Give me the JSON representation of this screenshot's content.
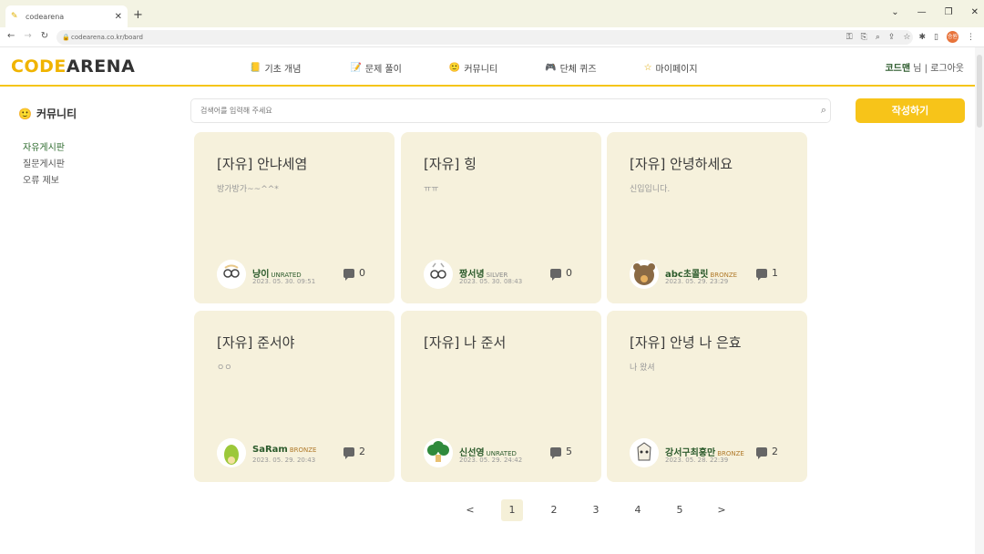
{
  "browser": {
    "tab_title": "codearena",
    "url": "codearena.co.kr/board",
    "profile_initials": "승원"
  },
  "site": {
    "logo_code": "CODE",
    "logo_arena": "ARENA",
    "nav": [
      {
        "label": "기초 개념",
        "icon": "book-icon"
      },
      {
        "label": "문제 풀이",
        "icon": "note-icon"
      },
      {
        "label": "커뮤니티",
        "icon": "community-icon"
      },
      {
        "label": "단체 퀴즈",
        "icon": "gamepad-icon"
      },
      {
        "label": "마이페이지",
        "icon": "star-icon"
      }
    ],
    "user_name": "코드맨",
    "user_suffix": "님 | 로그아웃"
  },
  "sidebar": {
    "title": "커뮤니티",
    "items": [
      "자유게시판",
      "질문게시판",
      "오류 제보"
    ]
  },
  "search": {
    "placeholder": "검색어를 입력해 주세요"
  },
  "write_button": "작성하기",
  "posts": [
    {
      "title": "[자유] 안냐세염",
      "body": "방가방가~~^^*",
      "author": "냥이",
      "tier": "UNRATED",
      "date": "2023. 05. 30. 09:51",
      "comments": "0"
    },
    {
      "title": "[자유] 힝",
      "body": "ㅠㅠ",
      "author": "짱서녕",
      "tier": "SILVER",
      "date": "2023. 05. 30. 08:43",
      "comments": "0"
    },
    {
      "title": "[자유] 안녕하세요",
      "body": "신입입니다.",
      "author": "abc초콜릿",
      "tier": "BRONZE",
      "date": "2023. 05. 29. 23:29",
      "comments": "1"
    },
    {
      "title": "[자유] 준서야",
      "body": "ㅇㅇ",
      "author": "SaRam",
      "tier": "BRONZE",
      "date": "2023. 05. 29. 20:43",
      "comments": "2"
    },
    {
      "title": "[자유] 나 준서",
      "body": "",
      "author": "신선영",
      "tier": "UNRATED",
      "date": "2023. 05. 29. 24:42",
      "comments": "5"
    },
    {
      "title": "[자유] 안녕 나 은효",
      "body": "나 왔셔",
      "author": "강서구최홍만",
      "tier": "BRONZE",
      "date": "2023. 05. 28. 22:39",
      "comments": "2"
    }
  ],
  "pagination": {
    "prev": "<",
    "pages": [
      "1",
      "2",
      "3",
      "4",
      "5"
    ],
    "current": "1",
    "next": ">"
  },
  "colors": {
    "accent": "#f7c419",
    "card_bg": "#f6f1dc",
    "bronze": "#b07a2a",
    "silver": "#8a8a8a",
    "unrated": "#2b5a2b"
  }
}
